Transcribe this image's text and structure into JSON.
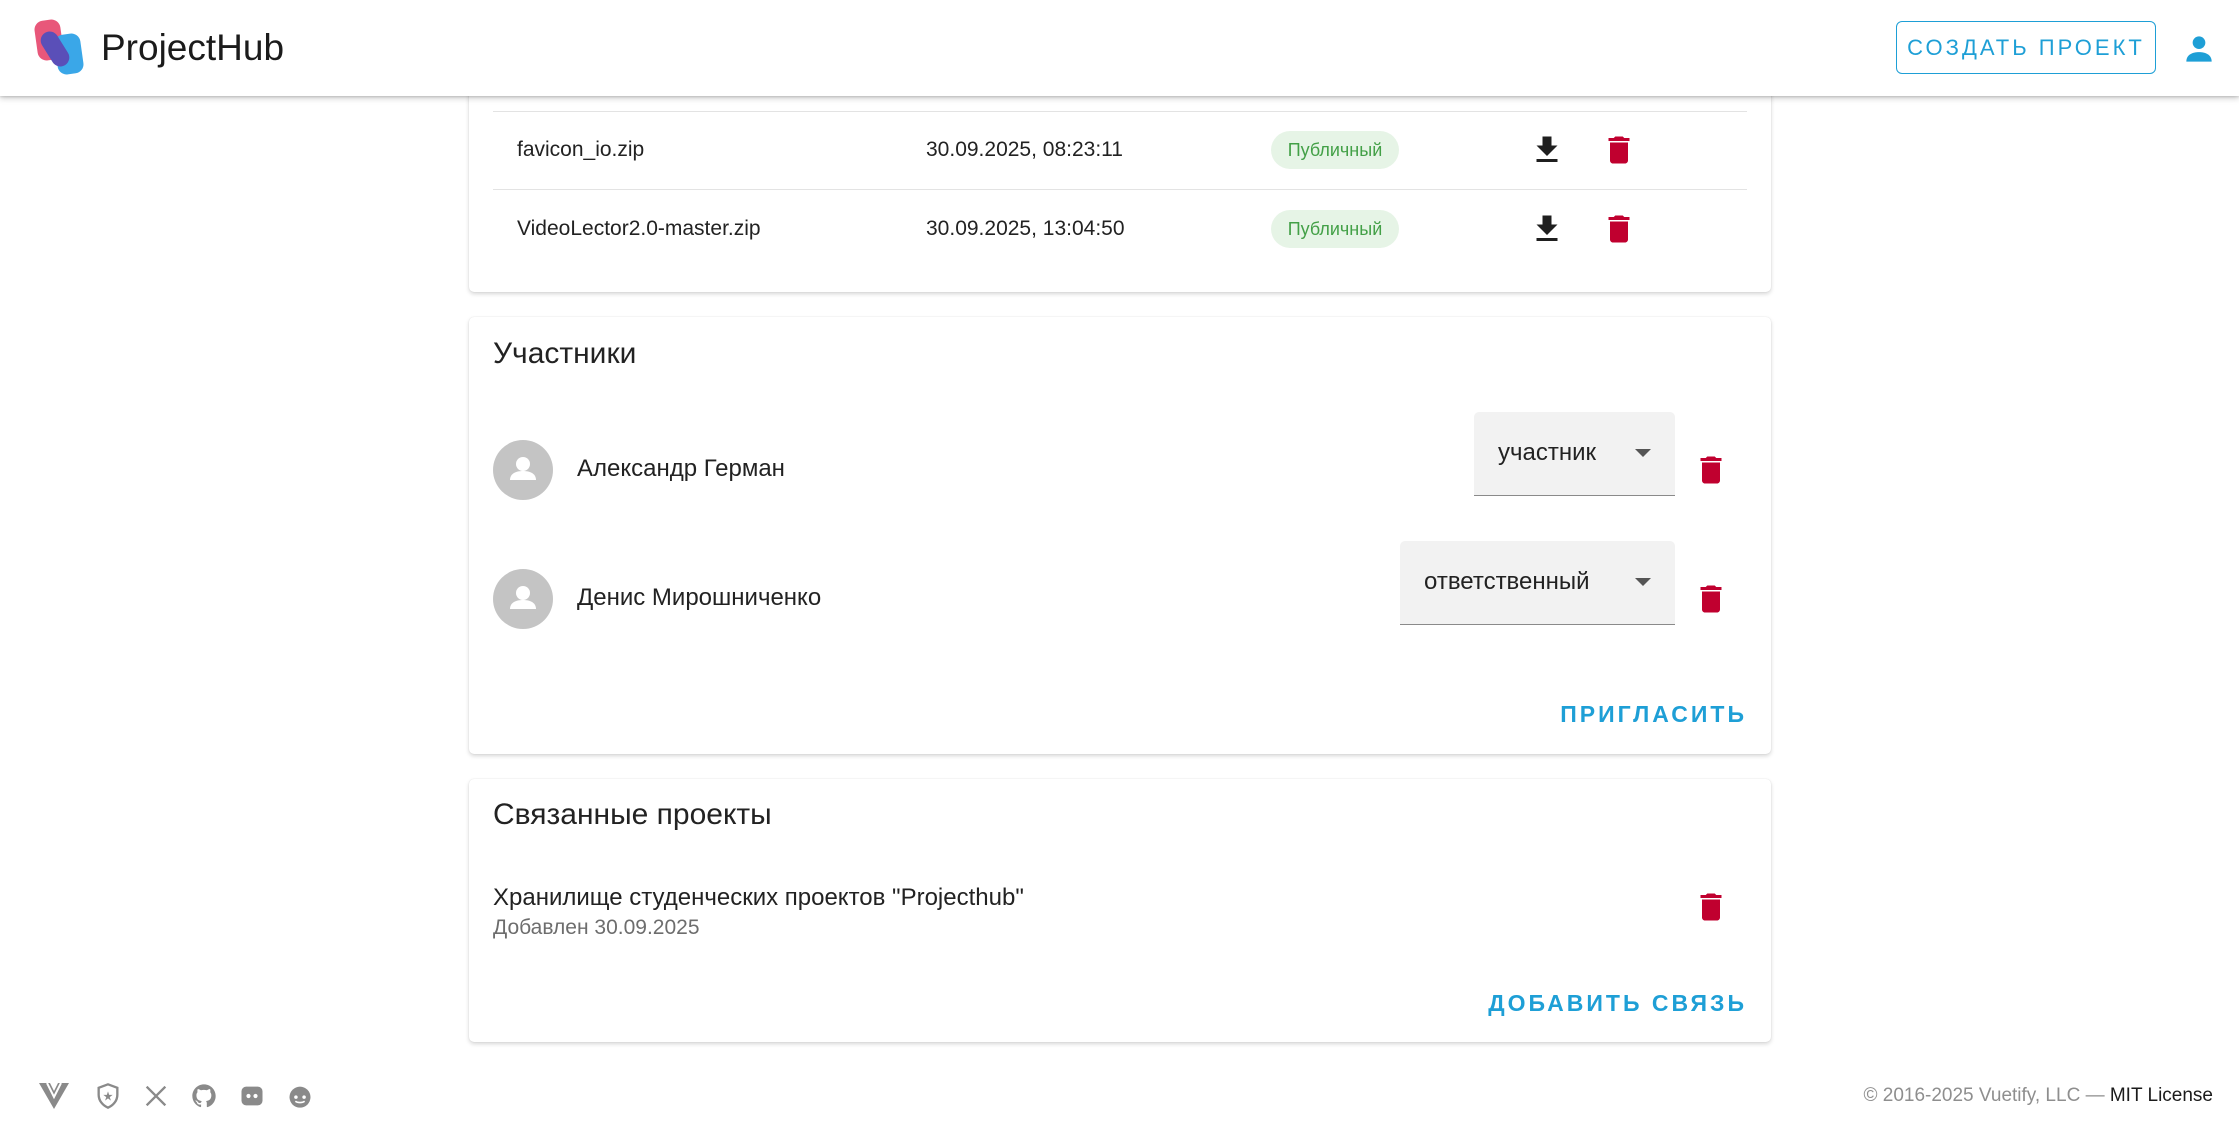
{
  "app": {
    "title": "ProjectHub",
    "create_button": "СОЗДАТЬ ПРОЕКТ"
  },
  "colors": {
    "accent": "#1e9fd6",
    "delete": "#c0002f",
    "chip_bg": "#e6f4e6",
    "chip_text": "#43a047"
  },
  "files": {
    "rows": [
      {
        "name": "favicon_io.zip",
        "date": "30.09.2025, 08:23:11",
        "visibility": "Публичный"
      },
      {
        "name": "VideoLector2.0-master.zip",
        "date": "30.09.2025, 13:04:50",
        "visibility": "Публичный"
      }
    ]
  },
  "members": {
    "title": "Участники",
    "items": [
      {
        "name": "Александр Герман",
        "role": "участник"
      },
      {
        "name": "Денис Мирошниченко",
        "role": "ответственный"
      }
    ],
    "invite_button": "ПРИГЛАСИТЬ"
  },
  "linked": {
    "title": "Связанные проекты",
    "items": [
      {
        "title": "Хранилище студенческих проектов \"Projecthub\"",
        "added": "Добавлен 30.09.2025"
      }
    ],
    "add_button": "ДОБАВИТЬ СВЯЗЬ"
  },
  "footer": {
    "icons": [
      "vuetify-logo-icon",
      "shield-icon",
      "x-twitter-icon",
      "github-icon",
      "discord-icon",
      "reddit-icon"
    ],
    "copyright": "© 2016-2025 Vuetify, LLC —",
    "license": "MIT License"
  }
}
